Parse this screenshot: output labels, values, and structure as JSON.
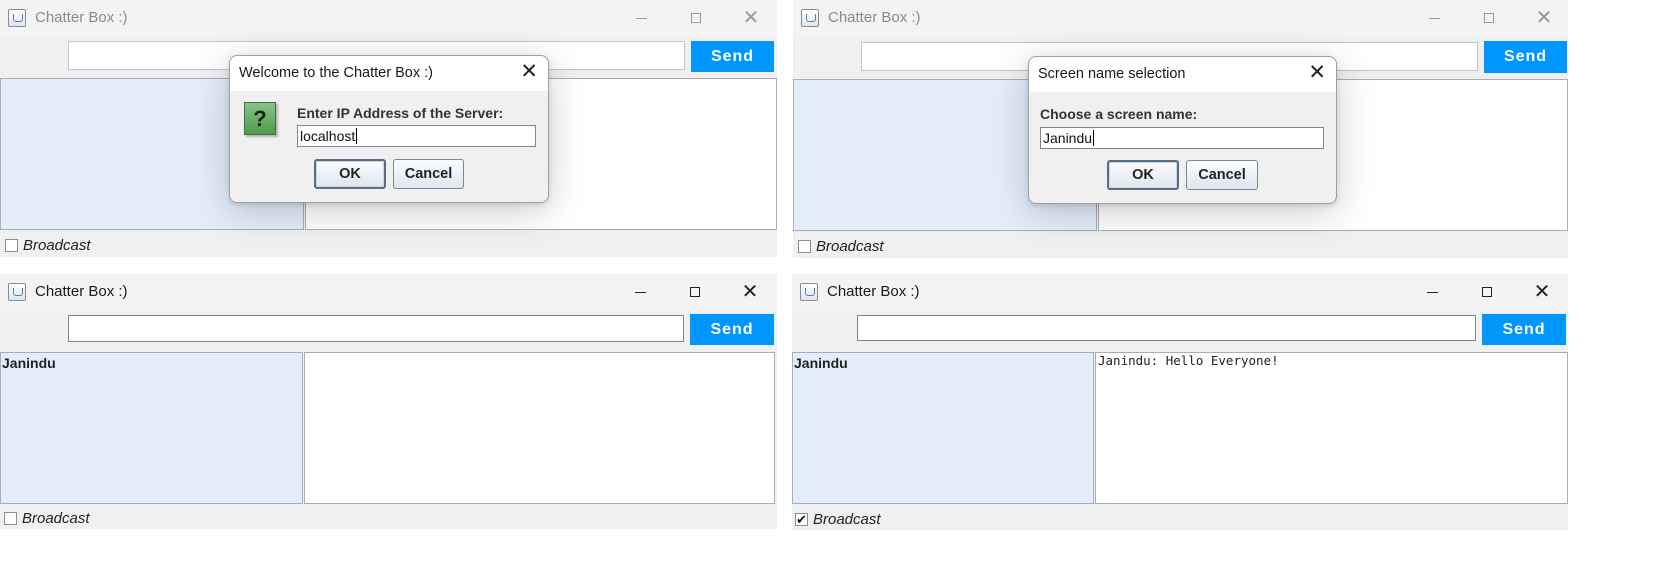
{
  "windows": [
    {
      "title": "Chatter Box :)",
      "send_label": "Send",
      "message_value": "",
      "users": [],
      "messages": "",
      "broadcast_label": "Broadcast",
      "broadcast_checked": false,
      "focused": false,
      "dialog": {
        "title": "Welcome to the Chatter Box :)",
        "prompt": "Enter IP Address of the Server:",
        "input_value": "localhost",
        "ok_label": "OK",
        "cancel_label": "Cancel",
        "icon": "question-icon"
      }
    },
    {
      "title": "Chatter Box :)",
      "send_label": "Send",
      "message_value": "",
      "users": [],
      "messages": "",
      "broadcast_label": "Broadcast",
      "broadcast_checked": false,
      "focused": false,
      "dialog": {
        "title": "Screen name selection",
        "prompt": "Choose a screen name:",
        "input_value": "Janindu",
        "ok_label": "OK",
        "cancel_label": "Cancel"
      }
    },
    {
      "title": "Chatter Box :)",
      "send_label": "Send",
      "message_value": "",
      "users": [
        "Janindu"
      ],
      "messages": "",
      "broadcast_label": "Broadcast",
      "broadcast_checked": false,
      "focused": true
    },
    {
      "title": "Chatter Box :)",
      "send_label": "Send",
      "message_value": "",
      "users": [
        "Janindu"
      ],
      "messages": "Janindu: Hello Everyone!",
      "broadcast_label": "Broadcast",
      "broadcast_checked": true,
      "focused": true
    }
  ],
  "icons": {
    "title_icon": "java-app-icon",
    "minimize": "minimize-icon",
    "maximize": "maximize-icon",
    "close": "close-icon"
  },
  "colors": {
    "send_button": "#0096ff",
    "user_list_bg": "#e3edfc",
    "window_bg": "#f0f0f0"
  }
}
